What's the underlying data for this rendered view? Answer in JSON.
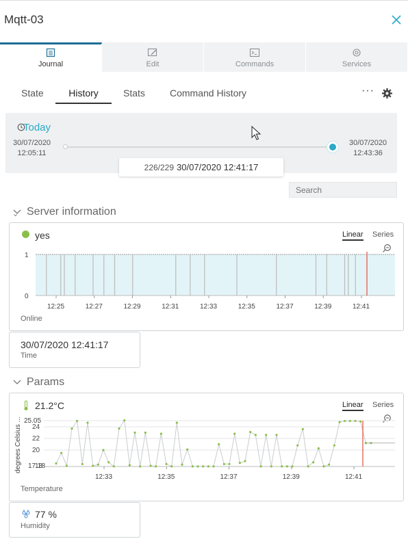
{
  "header": {
    "title": "Mqtt-03"
  },
  "tabs": [
    {
      "label": "Journal"
    },
    {
      "label": "Edit"
    },
    {
      "label": "Commands"
    },
    {
      "label": "Services"
    }
  ],
  "subtabs": [
    "State",
    "History",
    "Stats",
    "Command History"
  ],
  "more_label": "···",
  "range": {
    "label": "Today",
    "start_date": "30/07/2020",
    "start_time": "12:05:11",
    "end_date": "30/07/2020",
    "end_time": "12:43:36",
    "position": 1.0,
    "index": "226/229",
    "current": "30/07/2020 12:41:17"
  },
  "search": {
    "placeholder": "Search"
  },
  "sections": {
    "server": "Server information",
    "params": "Params"
  },
  "toggles": {
    "linear": "Linear",
    "series": "Series"
  },
  "online": {
    "value": "yes",
    "label": "Online",
    "color": "#8cbf4a"
  },
  "time": {
    "value": "30/07/2020 12:41:17",
    "label": "Time"
  },
  "temperature": {
    "value": "21.2°C",
    "label": "Temperature"
  },
  "humidity": {
    "value": "77 %",
    "label": "Humidity"
  },
  "chart_data": [
    {
      "type": "area",
      "xlabel": "",
      "ylabel": "",
      "x_ticks": [
        "12:25",
        "12:27",
        "12:29",
        "12:31",
        "12:33",
        "12:35",
        "12:37",
        "12:39",
        "12:41"
      ],
      "y_ticks": [
        "1",
        "0"
      ],
      "ylim": [
        0,
        1
      ],
      "grid": true,
      "fill_color": "#e3f4f8",
      "cursor_color": "#e05a4a",
      "cursor_time": "12:41"
    },
    {
      "type": "line",
      "xlabel": "",
      "ylabel": "degrees Celsius ...",
      "x_ticks": [
        "12:33",
        "12:35",
        "12:37",
        "12:39",
        "12:41"
      ],
      "y_ticks": [
        "25.05",
        "24",
        "22",
        "20",
        "17.18"
      ],
      "y_extra": "18",
      "ylim": [
        17.18,
        25.05
      ],
      "grid": true,
      "point_color": "#8cbf4a",
      "cursor_time": "12:41",
      "values": [
        17.7,
        19.5,
        17.3,
        23.7,
        25.0,
        17.6,
        24.7,
        17.3,
        17.5,
        20.0,
        17.9,
        17.2,
        23.7,
        25.1,
        17.4,
        23.0,
        17.2,
        23.0,
        17.3,
        17.2,
        22.8,
        17.6,
        17.2,
        24.7,
        17.5,
        20.1,
        17.2,
        17.2,
        17.2,
        17.2,
        17.2,
        21.0,
        17.6,
        17.6,
        22.8,
        17.8,
        18.1,
        23.1,
        22.6,
        17.2,
        22.6,
        17.2,
        22.6,
        17.2,
        17.2,
        17.2,
        20.8,
        23.6,
        17.2,
        17.9,
        20.3,
        17.2,
        17.5,
        20.8,
        24.8,
        25.0,
        25.0,
        25.0,
        24.9,
        21.2,
        21.2
      ]
    }
  ]
}
